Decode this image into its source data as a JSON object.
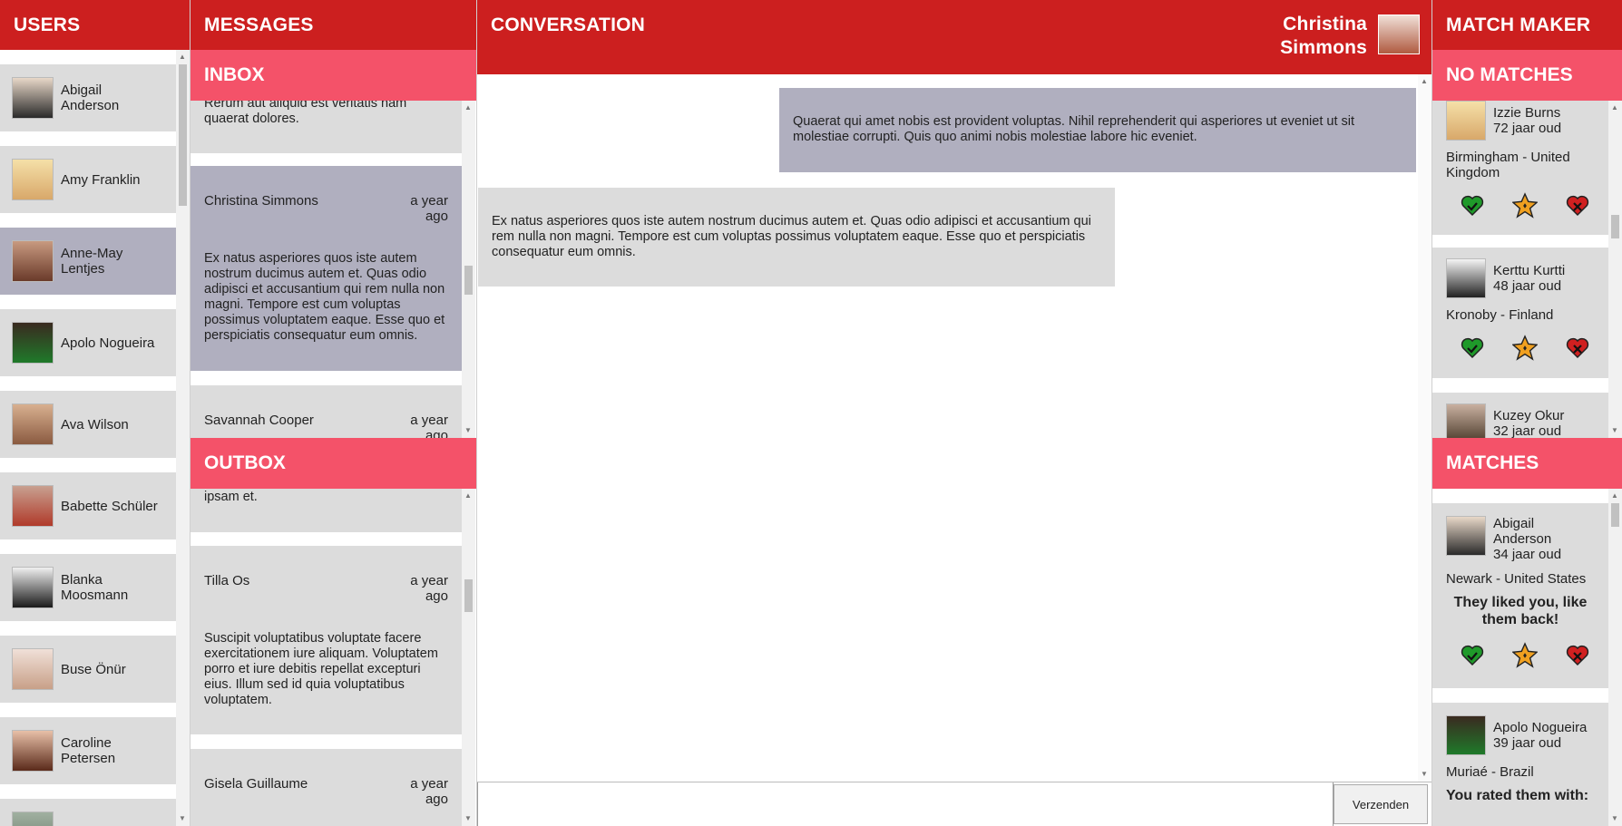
{
  "users": {
    "title": "USERS",
    "items": [
      {
        "name": "Abigail Anderson",
        "avatar_color": "#2a2a2a"
      },
      {
        "name": "Amy Franklin",
        "avatar_color": "#e8c98a"
      },
      {
        "name": "Anne-May Lentjes",
        "avatar_color": "#8a4a3a",
        "active": true
      },
      {
        "name": "Apolo Nogueira",
        "avatar_color": "#1f6a2a"
      },
      {
        "name": "Ava Wilson",
        "avatar_color": "#b07a55"
      },
      {
        "name": "Babette Schüler",
        "avatar_color": "#b03a2a"
      },
      {
        "name": "Blanka Moosmann",
        "avatar_color": "#1a1a1a"
      },
      {
        "name": "Buse Önür",
        "avatar_color": "#d8b095"
      },
      {
        "name": "Caroline Petersen",
        "avatar_color": "#6a3a2a"
      },
      {
        "name": "",
        "avatar_color": "#7a8a7a"
      }
    ]
  },
  "messages": {
    "title": "MESSAGES",
    "inbox": {
      "title": "INBOX",
      "fragment": "Rerum aut aliquid est veritatis nam quaerat dolores.",
      "cards": [
        {
          "sender": "Christina Simmons",
          "time": "a year ago",
          "body": "Ex natus asperiores quos iste autem nostrum ducimus autem et. Quas odio adipisci et accusantium qui rem nulla non magni. Tempore est cum voluptas possimus voluptatem eaque. Esse quo et perspiciatis consequatur eum omnis."
        },
        {
          "sender": "Savannah Cooper",
          "time": "a year ago",
          "body": ""
        }
      ]
    },
    "outbox": {
      "title": "OUTBOX",
      "fragment": "ipsam et.",
      "cards": [
        {
          "sender": "Tilla Os",
          "time": "a year ago",
          "body": "Suscipit voluptatibus voluptate facere exercitationem iure aliquam. Voluptatem porro et iure debitis repellat excepturi eius. Illum sed id quia voluptatibus voluptatem."
        },
        {
          "sender": "Gisela Guillaume",
          "time": "a year ago",
          "body": ""
        }
      ]
    }
  },
  "conversation": {
    "title": "CONVERSATION",
    "contact_name_line1": "Christina",
    "contact_name_line2": "Simmons",
    "messages": [
      {
        "direction": "out",
        "text": "Quaerat qui amet nobis est provident voluptas. Nihil reprehenderit qui asperiores ut eveniet ut sit molestiae corrupti. Quis quo animi nobis molestiae labore hic eveniet."
      },
      {
        "direction": "in",
        "text": "Ex natus asperiores quos iste autem nostrum ducimus autem et. Quas odio adipisci et accusantium qui rem nulla non magni. Tempore est cum voluptas possimus voluptatem eaque. Esse quo et perspiciatis consequatur eum omnis."
      }
    ],
    "compose_placeholder": "",
    "send_label": "Verzenden"
  },
  "matchmaker": {
    "title": "MATCH MAKER",
    "no_matches": {
      "title": "NO MATCHES",
      "cards": [
        {
          "name": "Izzie Burns",
          "age": "72 jaar oud",
          "location": "Birmingham - United Kingdom"
        },
        {
          "name": "Kerttu Kurtti",
          "age": "48 jaar oud",
          "location": "Kronoby - Finland"
        },
        {
          "name": "Kuzey Okur",
          "age": "32 jaar oud",
          "location": ""
        }
      ]
    },
    "matches": {
      "title": "MATCHES",
      "cards": [
        {
          "name": "Abigail Anderson",
          "age": "34 jaar oud",
          "location": "Newark - United States",
          "status": "They liked you, like them back!"
        },
        {
          "name": "Apolo Nogueira",
          "age": "39 jaar oud",
          "location": "Muriaé - Brazil",
          "status": "You rated them with:"
        }
      ]
    }
  },
  "colors": {
    "header_red": "#cc1f1f",
    "subheader_pink": "#f45269",
    "card_gray": "#dcdcdc",
    "card_active": "#b0afbf",
    "like_green": "#1f9a2a",
    "star_orange": "#f0a020",
    "dislike_red": "#d02020"
  }
}
